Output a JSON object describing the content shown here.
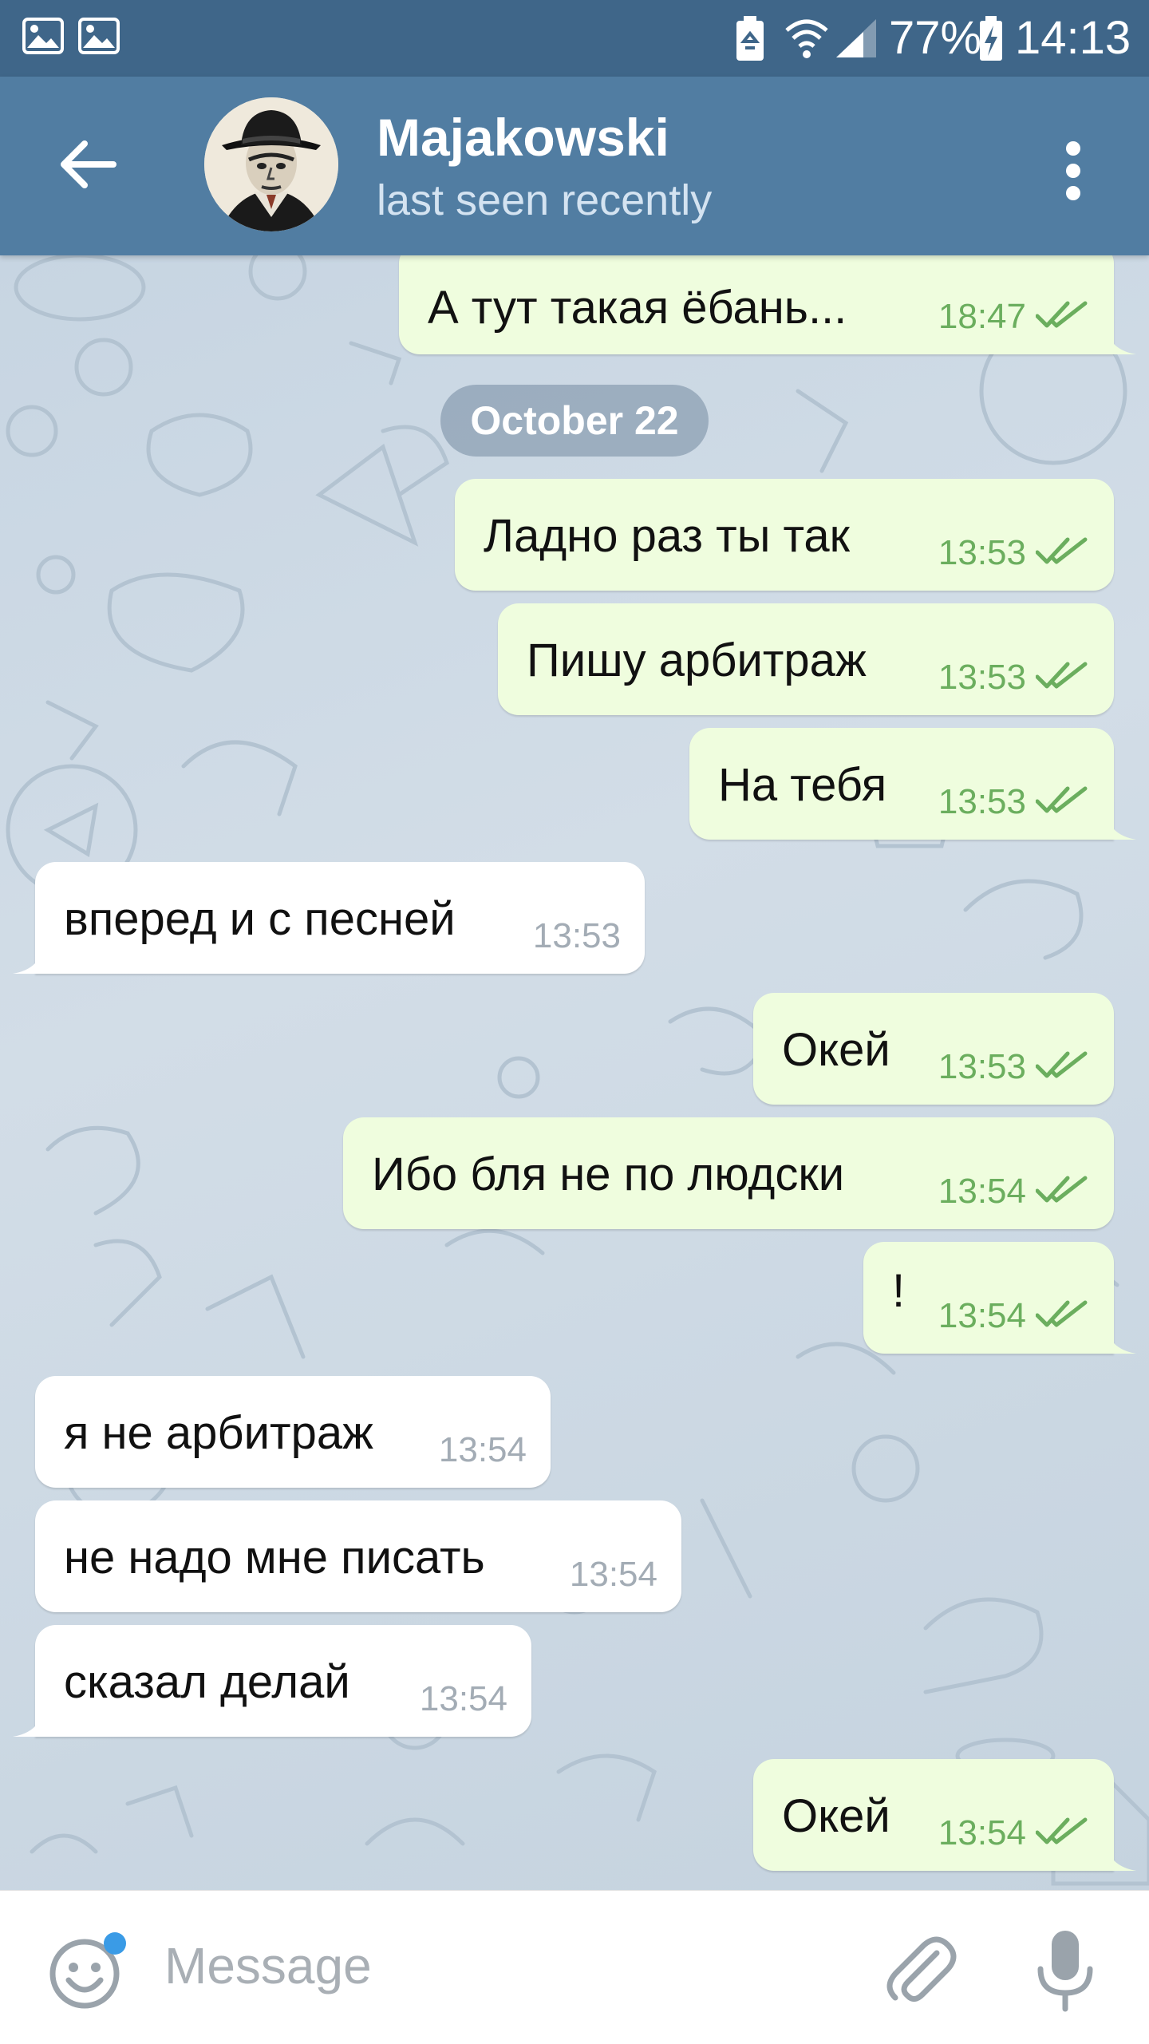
{
  "status_bar": {
    "battery_percent": "77%",
    "time": "14:13",
    "icons": [
      "gallery-icon",
      "gallery-icon",
      "battery-saver-icon",
      "wifi-icon",
      "signal-icon",
      "battery-charging-icon"
    ]
  },
  "header": {
    "title": "Majakowski",
    "status": "last seen recently",
    "icons": [
      "back-arrow-icon",
      "avatar",
      "more-vert-icon"
    ]
  },
  "chat": {
    "date_separator": "October 22",
    "messages": [
      {
        "dir": "out",
        "text": "А тут такая ёбань...",
        "time": "18:47",
        "read": true
      },
      {
        "dir": "out",
        "text": "Ладно раз ты так",
        "time": "13:53",
        "read": true
      },
      {
        "dir": "out",
        "text": "Пишу арбитраж",
        "time": "13:53",
        "read": true
      },
      {
        "dir": "out",
        "text": "На тебя",
        "time": "13:53",
        "read": true
      },
      {
        "dir": "in",
        "text": "вперед и с песней",
        "time": "13:53"
      },
      {
        "dir": "out",
        "text": "Окей",
        "time": "13:53",
        "read": true
      },
      {
        "dir": "out",
        "text": "Ибо бля не по людски",
        "time": "13:54",
        "read": true
      },
      {
        "dir": "out",
        "text": "!",
        "time": "13:54",
        "read": true
      },
      {
        "dir": "in",
        "text": "я не арбитраж",
        "time": "13:54"
      },
      {
        "dir": "in",
        "text": "не надо мне писать",
        "time": "13:54"
      },
      {
        "dir": "in",
        "text": "сказал делай",
        "time": "13:54"
      },
      {
        "dir": "out",
        "text": "Окей",
        "time": "13:54",
        "read": true
      }
    ]
  },
  "input": {
    "placeholder": "Message",
    "icons": [
      "emoji-icon",
      "attach-icon",
      "microphone-icon"
    ]
  },
  "colors": {
    "status_bar": "#3f6689",
    "app_bar": "#517da2",
    "outgoing_bubble": "#effdde",
    "incoming_bubble": "#ffffff",
    "outgoing_time": "#6bae5e",
    "incoming_time": "#a3acb5",
    "emoji_badge": "#3a9be6"
  }
}
